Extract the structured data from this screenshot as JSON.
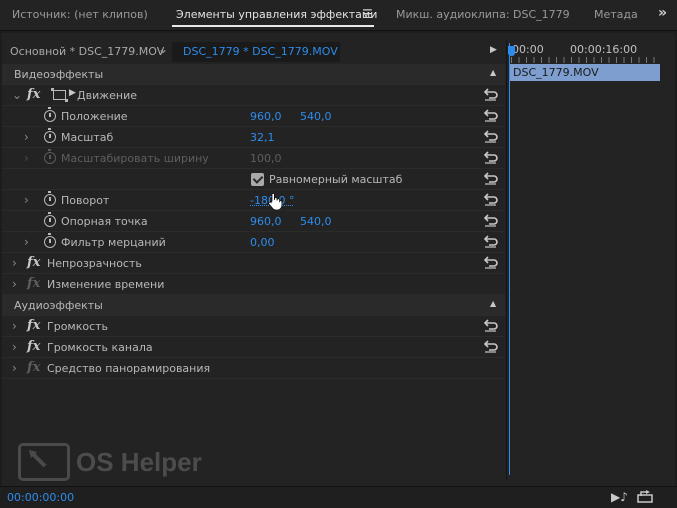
{
  "tabs": [
    {
      "label": "Источник: (нет клипов)",
      "active": false
    },
    {
      "label": "Элементы управления эффектами",
      "active": true
    },
    {
      "label": "Микш. аудиоклипа: DSC_1779",
      "active": false
    },
    {
      "label": "Метада",
      "active": false
    }
  ],
  "tab_menu_icon": "hamburger-icon",
  "tab_overflow_icon": "double-chevron-right-icon",
  "clip_header": {
    "master_clip": "Основной * DSC_1779.MOV",
    "sequence_clip": "DSC_1779 * DSC_1779.MOV"
  },
  "sections": {
    "video": "Видеоэффекты",
    "audio": "Аудиоэффекты"
  },
  "effects": {
    "motion": {
      "name": "Движение",
      "position": {
        "label": "Положение",
        "x": "960,0",
        "y": "540,0"
      },
      "scale": {
        "label": "Масштаб",
        "value": "32,1"
      },
      "scale_width": {
        "label": "Масштабировать ширину",
        "value": "100,0"
      },
      "uniform_scale": {
        "label": "Равномерный масштаб",
        "checked": true
      },
      "rotation": {
        "label": "Поворот",
        "value": "-180,0 °"
      },
      "anchor": {
        "label": "Опорная точка",
        "x": "960,0",
        "y": "540,0"
      },
      "flicker": {
        "label": "Фильтр мерцаний",
        "value": "0,00"
      }
    },
    "opacity": "Непрозрачность",
    "time_remap": "Изменение времени",
    "volume": "Громкость",
    "channel_volume": "Громкость канала",
    "panner": "Средство панорамирования"
  },
  "timeline": {
    "start": "00:00",
    "end": "00:00:16:00",
    "clip_name": "DSC_1779.MOV"
  },
  "current_time": "00:00:00:00",
  "watermark": "OS Helper",
  "colors": {
    "accent_blue": "#2d8ceb",
    "clip_bar": "#7d9ecf",
    "background": "#232323"
  }
}
